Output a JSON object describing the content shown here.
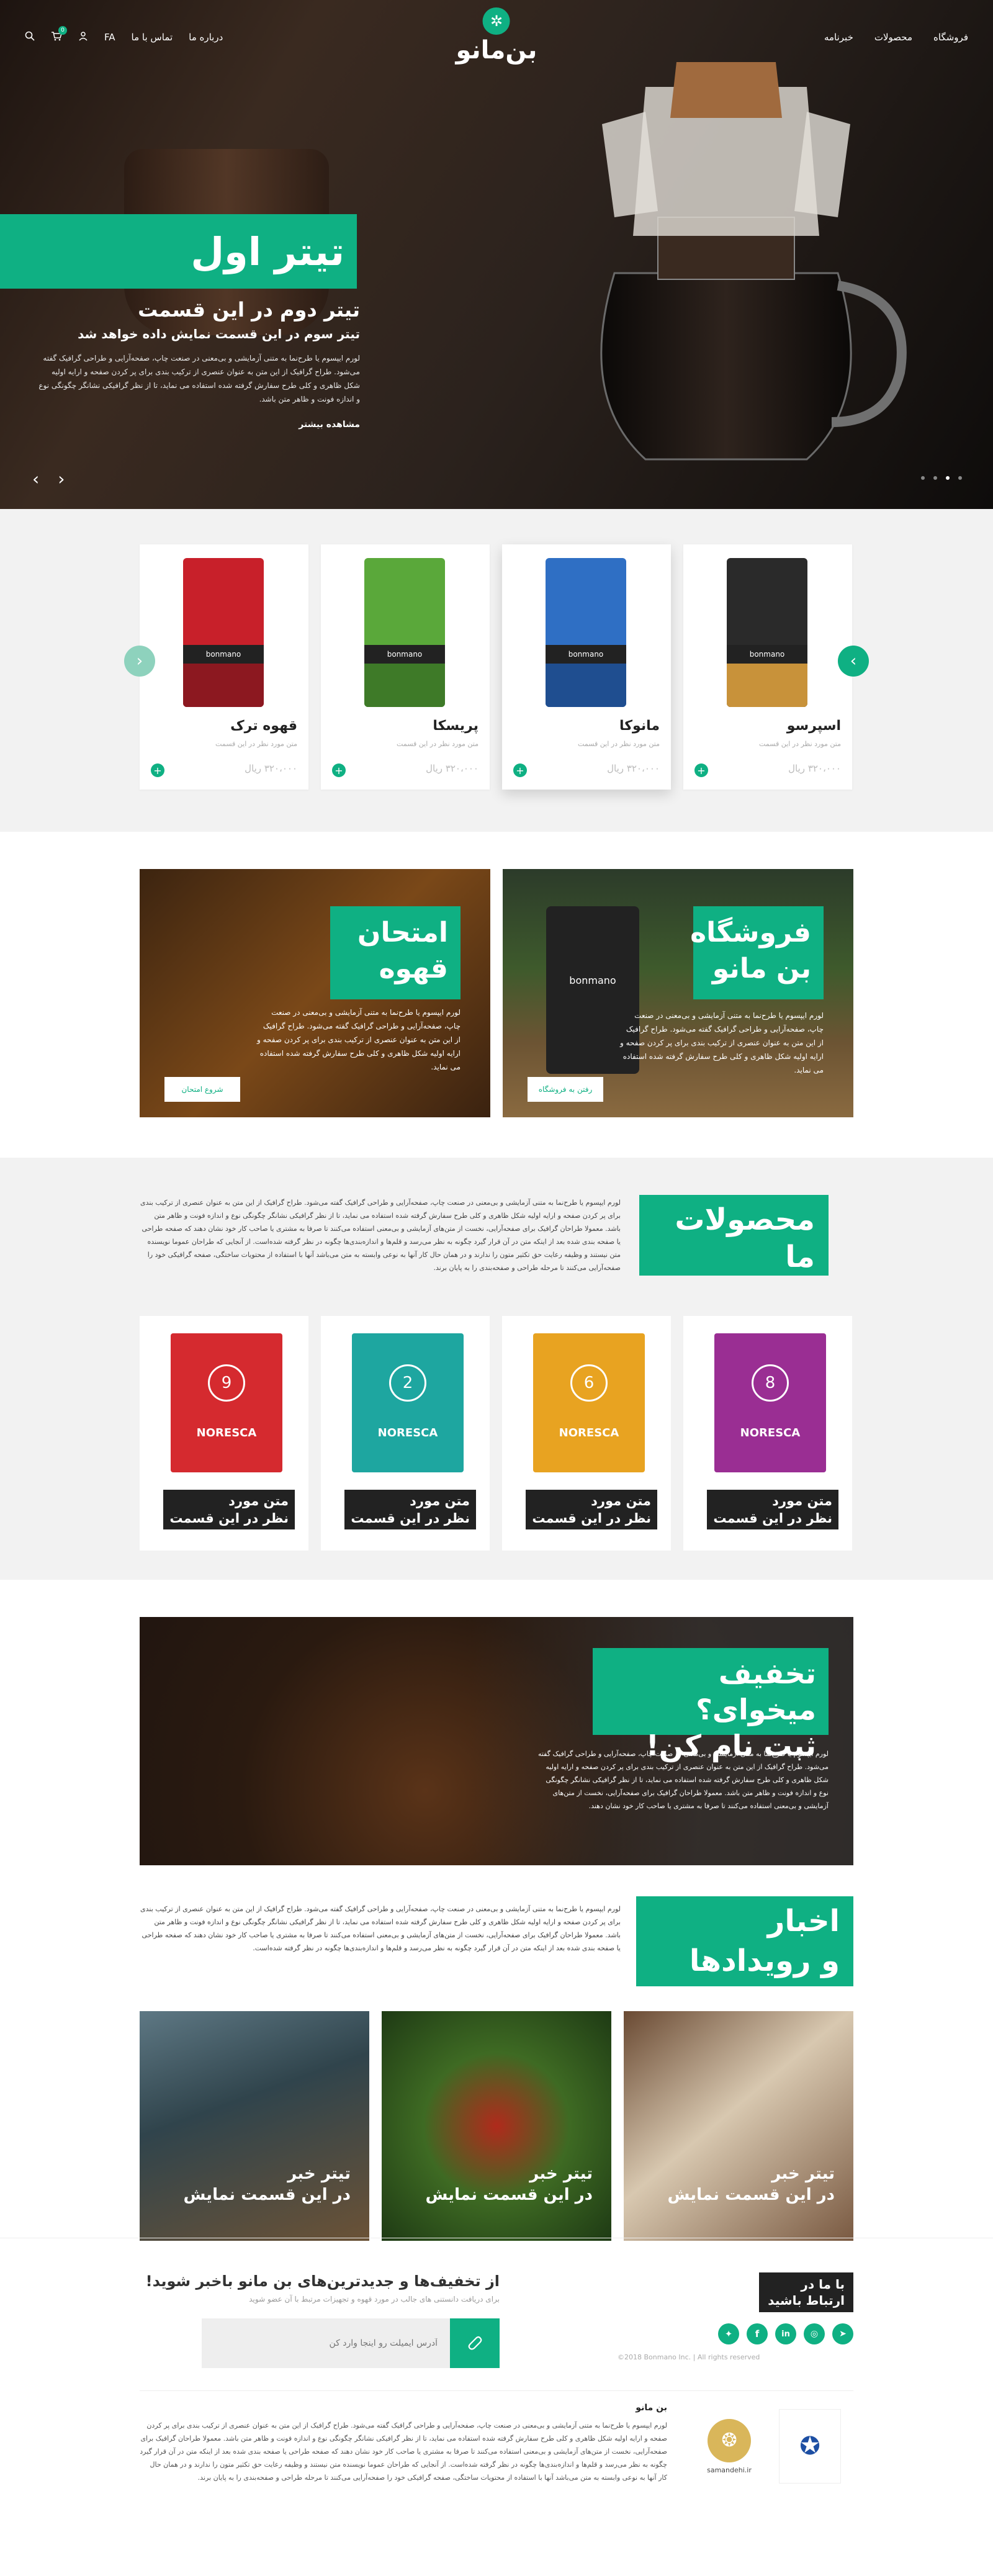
{
  "header": {
    "logo_text": "بن‌مانو",
    "nav": [
      "فروشگاه",
      "محصولات",
      "خبرنامه",
      "درباره ما",
      "تماس با ما"
    ],
    "lang": "FA",
    "cart_count": "0"
  },
  "hero": {
    "title1": "تیتر اول",
    "title2": "تیتر دوم در این قسمت",
    "title3": "تیتر سوم در این قسمت نمایش داده خواهد شد",
    "text": "لورم ایپسوم یا طرح‌نما به متنی آزمایشی و بی‌معنی در صنعت چاپ، صفحه‌آرایی و طراحی گرافیک گفته می‌شود. طراح گرافیک از این متن به عنوان عنصری از ترکیب بندی برای پر کردن صفحه و ارایه اولیه شکل ظاهری و کلی طرح سفارش گرفته شده استفاده می نماید، تا از نظر گرافیکی نشانگر چگونگی نوع و اندازه فونت و ظاهر متن باشد.",
    "more": "مشاهده بیشتر",
    "prev_icon": "‹",
    "next_icon": "›"
  },
  "products_carousel": [
    {
      "name": "قهوه ترک",
      "desc": "متن مورد نظر در این قسمت",
      "price": "۳۲۰،۰۰۰ ریال",
      "color": "#c8202a",
      "band": "bonmano"
    },
    {
      "name": "پریسکا",
      "desc": "متن مورد نظر در این قسمت",
      "price": "۳۲۰،۰۰۰ ریال",
      "color": "#5aa83a",
      "band": "bonmano"
    },
    {
      "name": "مانوکا",
      "desc": "متن مورد نظر در این قسمت",
      "price": "۳۲۰،۰۰۰ ریال",
      "color": "#2f6fc4",
      "band": "bonmano"
    },
    {
      "name": "اسپرسو",
      "desc": "متن مورد نظر در این قسمت",
      "price": "۳۲۰،۰۰۰ ریال",
      "color": "#c8923a",
      "band": "bonmano"
    }
  ],
  "tiles": {
    "shop": {
      "title_l1": "فروشگاه",
      "title_l2": "بن مانو",
      "text": "لورم ایپسوم یا طرح‌نما به متنی آزمایشی و بی‌معنی در صنعت چاپ، صفحه‌آرایی و طراحی گرافیک گفته می‌شود. طراح گرافیک از این متن به عنوان عنصری از ترکیب بندی برای پر کردن صفحه و ارایه اولیه شکل ظاهری و کلی طرح سفارش گرفته شده استفاده می نماید.",
      "button": "رفتن به فروشگاه",
      "bag_label": "bonmano"
    },
    "quiz": {
      "title_l1": "امتحان",
      "title_l2": "قهوه",
      "text": "لورم ایپسوم یا طرح‌نما به متنی آزمایشی و بی‌معنی در صنعت چاپ، صفحه‌آرایی و طراحی گرافیک گفته می‌شود. طراح گرافیک از این متن به عنوان عنصری از ترکیب بندی برای پر کردن صفحه و ارایه اولیه شکل ظاهری و کلی طرح سفارش گرفته شده استفاده می نماید.",
      "button": "شروع امتحان"
    }
  },
  "our_products": {
    "title_l1": "محصولات",
    "title_l2": "ما",
    "text": "لورم ایپسوم یا طرح‌نما به متنی آزمایشی و بی‌معنی در صنعت چاپ، صفحه‌آرایی و طراحی گرافیک گفته می‌شود. طراح گرافیک از این متن به عنوان عنصری از ترکیب بندی برای پر کردن صفحه و ارایه اولیه شکل ظاهری و کلی طرح سفارش گرفته شده استفاده می نماید، تا از نظر گرافیکی نشانگر چگونگی نوع و اندازه فونت و ظاهر متن باشد. معمولا طراحان گرافیک برای صفحه‌آرایی، نخست از متن‌های آزمایشی و بی‌معنی استفاده می‌کنند تا صرفا به مشتری یا صاحب کار خود نشان دهند که صفحه طراحی یا صفحه بندی شده بعد از اینکه متن در آن قرار گیرد چگونه به نظر می‌رسد و قلم‌ها و اندازه‌بندی‌ها چگونه در نظر گرفته شده‌است. از آنجایی که طراحان عموما نویسنده متن نیستند و وظیفه رعایت حق تکثیر متون را ندارند و در همان حال کار آنها به نوعی وابسته به متن می‌باشد آنها با استفاده از محتویات ساختگی، صفحه گرافیکی خود را صفحه‌آرایی می‌کنند تا مرحله طراحی و صفحه‌بندی را به پایان برند.",
    "items": [
      {
        "label_l1": "متن مورد",
        "label_l2": "نظر در این قسمت",
        "number": "9",
        "brand": "NORESCA",
        "color": "#d52a2f"
      },
      {
        "label_l1": "متن مورد",
        "label_l2": "نظر در این قسمت",
        "number": "2",
        "brand": "NORESCA",
        "color": "#1ea6a0"
      },
      {
        "label_l1": "متن مورد",
        "label_l2": "نظر در این قسمت",
        "number": "6",
        "brand": "NORESCA",
        "color": "#e8a321"
      },
      {
        "label_l1": "متن مورد",
        "label_l2": "نظر در این قسمت",
        "number": "8",
        "brand": "NORESCA",
        "color": "#9a2e93"
      }
    ]
  },
  "discount": {
    "title_l1": "تخفیف میخوای؟",
    "title_l2": "ثبت نام کن!",
    "text": "لورم ایپسوم یا طرح‌نما به متنی آزمایشی و بی‌معنی در صنعت چاپ، صفحه‌آرایی و طراحی گرافیک گفته می‌شود. طراح گرافیک از این متن به عنوان عنصری از ترکیب بندی برای پر کردن صفحه و ارایه اولیه شکل ظاهری و کلی طرح سفارش گرفته شده استفاده می نماید، تا از نظر گرافیکی نشانگر چگونگی نوع و اندازه فونت و ظاهر متن باشد. معمولا طراحان گرافیک برای صفحه‌آرایی، نخست از متن‌های آزمایشی و بی‌معنی استفاده می‌کنند تا صرفا به مشتری یا صاحب کار خود نشان دهند."
  },
  "news": {
    "title_l1": "اخبار",
    "title_l2": "و رویدادها",
    "text": "لورم ایپسوم یا طرح‌نما به متنی آزمایشی و بی‌معنی در صنعت چاپ، صفحه‌آرایی و طراحی گرافیک گفته می‌شود. طراح گرافیک از این متن به عنوان عنصری از ترکیب بندی برای پر کردن صفحه و ارایه اولیه شکل ظاهری و کلی طرح سفارش گرفته شده استفاده می نماید، تا از نظر گرافیکی نشانگر چگونگی نوع و اندازه فونت و ظاهر متن باشد. معمولا طراحان گرافیک برای صفحه‌آرایی، نخست از متن‌های آزمایشی و بی‌معنی استفاده می‌کنند تا صرفا به مشتری یا صاحب کار خود نشان دهند که صفحه طراحی یا صفحه بندی شده بعد از اینکه متن در آن قرار گیرد چگونه به نظر می‌رسد و قلم‌ها و اندازه‌بندی‌ها چگونه در نظر گرفته شده‌است.",
    "items": [
      {
        "title_l1": "تیتر خبر",
        "title_l2": "در این قسمت نمایش"
      },
      {
        "title_l1": "تیتر خبر",
        "title_l2": "در این قسمت نمایش"
      },
      {
        "title_l1": "تیتر خبر",
        "title_l2": "در این قسمت نمایش"
      }
    ]
  },
  "subscribe": {
    "title": "از تخفیف‌ها و جدیدترین‌های بن مانو باخبر شوید!",
    "subtitle": "برای دریافت دانستنی های جالب در مورد قهوه و تجهیزات مرتبط با آن عضو شوید",
    "placeholder": "آدرس ایمیلت رو اینجا وارد کن"
  },
  "contact": {
    "title_l1": "با ما در",
    "title_l2": "ارتباط باشید",
    "copyright": "©2018 Bonmano Inc. | All rights reserved",
    "socials": [
      "telegram-icon",
      "instagram-icon",
      "linkedin-icon",
      "facebook-icon",
      "twitter-icon"
    ]
  },
  "footer": {
    "about_title": "بن مانو",
    "about_text": "لورم ایپسوم یا طرح‌نما به متنی آزمایشی و بی‌معنی در صنعت چاپ، صفحه‌آرایی و طراحی گرافیک گفته می‌شود. طراح گرافیک از این متن به عنوان عنصری از ترکیب بندی برای پر کردن صفحه و ارایه اولیه شکل ظاهری و کلی طرح سفارش گرفته شده استفاده می نماید، تا از نظر گرافیکی نشانگر چگونگی نوع و اندازه فونت و ظاهر متن باشد. معمولا طراحان گرافیک برای صفحه‌آرایی، نخست از متن‌های آزمایشی و بی‌معنی استفاده می‌کنند تا صرفا به مشتری یا صاحب کار خود نشان دهند که صفحه طراحی یا صفحه بندی شده بعد از اینکه متن در آن قرار گیرد چگونه به نظر می‌رسد و قلم‌ها و اندازه‌بندی‌ها چگونه در نظر گرفته شده‌است. از آنجایی که طراحان عموما نویسنده متن نیستند و وظیفه رعایت حق تکثیر متون را ندارند و در همان حال کار آنها به نوعی وابسته به متن می‌باشد آنها با استفاده از محتویات ساختگی، صفحه گرافیکی خود را صفحه‌آرایی می‌کنند تا مرحله طراحی و صفحه‌بندی را به پایان برند.",
    "samandehi_label": "samandehi.ir"
  },
  "colors": {
    "accent": "#0fb083",
    "dark": "#222222"
  }
}
